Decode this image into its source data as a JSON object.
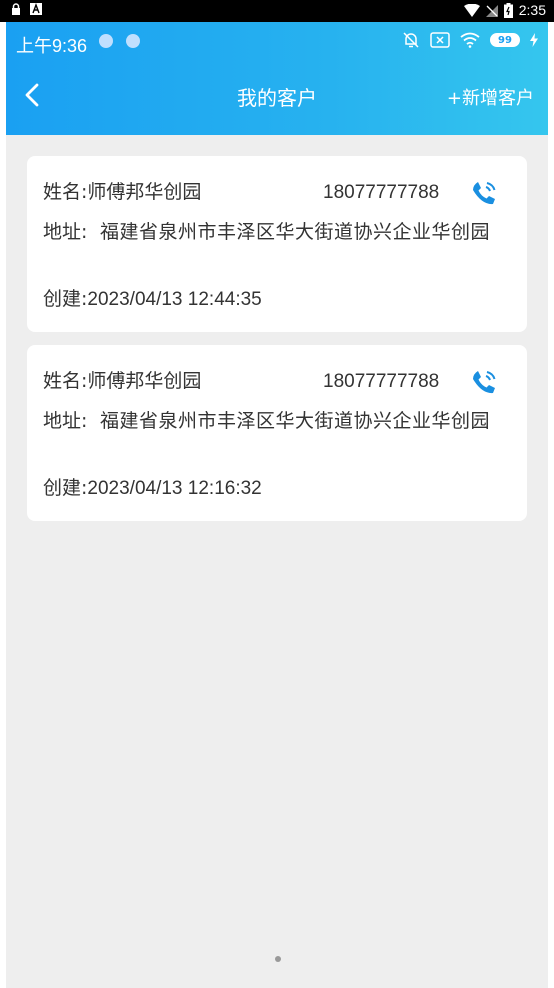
{
  "system_bar": {
    "time": "2:35"
  },
  "status_bar": {
    "clock": "上午9:36",
    "battery": "99"
  },
  "nav": {
    "title": "我的客户",
    "add_label": "+新增客户"
  },
  "labels": {
    "name": "姓名:",
    "address": "地址:",
    "created": "创建:"
  },
  "customers": [
    {
      "name": "师傅邦华创园",
      "phone": "18077777788",
      "address": "福建省泉州市丰泽区华大街道协兴企业华创园",
      "created": "2023/04/13 12:44:35"
    },
    {
      "name": "师傅邦华创园",
      "phone": "18077777788",
      "address": "福建省泉州市丰泽区华大街道协兴企业华创园",
      "created": "2023/04/13 12:16:32"
    }
  ],
  "colors": {
    "header_start": "#1aa0f2",
    "header_end": "#35c6ee",
    "phone_icon": "#1a8fe0"
  }
}
